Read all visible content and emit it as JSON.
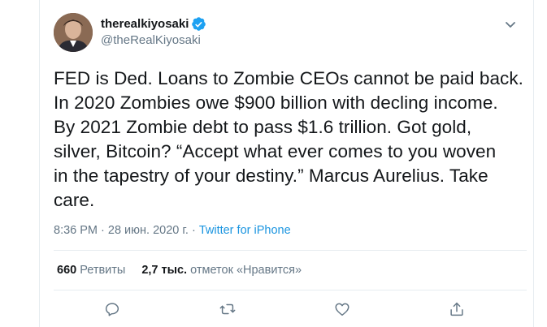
{
  "user": {
    "display_name": "therealkiyosaki",
    "handle": "@theRealKiyosaki",
    "verified": true
  },
  "tweet": {
    "text": "FED is Ded. Loans to Zombie CEOs cannot be paid back.\nIn 2020 Zombies owe $900 billion with decling income.\nBy 2021 Zombie debt to pass $1.6 trillion. Got gold,\nsilver, Bitcoin? “Accept what ever comes to you woven\nin the tapestry of your destiny.” Marcus Aurelius. Take\ncare.",
    "time": "8:36 PM",
    "date": "28 июн. 2020 г.",
    "separator": " · ",
    "source": "Twitter for iPhone"
  },
  "stats": {
    "retweets_count": "660",
    "retweets_label": "Ретвиты",
    "likes_count": "2,7 тыс.",
    "likes_label": "отметок «Нравится»"
  },
  "colors": {
    "accent": "#1b95e0",
    "verified": "#1da1f2",
    "muted": "#657786",
    "text": "#14171a"
  },
  "icons": {
    "actions": [
      "reply-icon",
      "retweet-icon",
      "like-icon",
      "share-icon"
    ],
    "menu": "chevron-down-icon"
  }
}
